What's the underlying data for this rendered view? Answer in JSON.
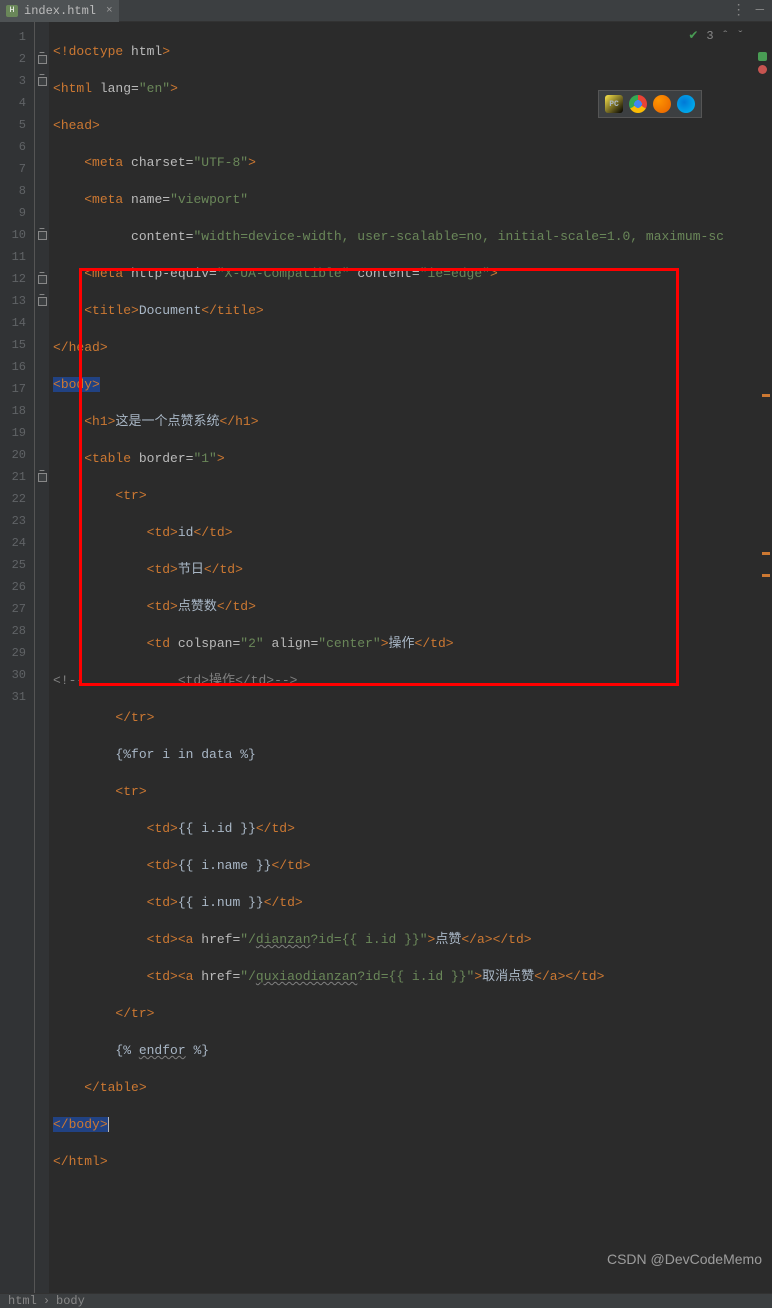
{
  "tab": {
    "filename": "index.html"
  },
  "topright": {
    "warnings": "3"
  },
  "breadcrumb": {
    "c1": "html",
    "c2": "body"
  },
  "watermark": "CSDN @DevCodeMemo",
  "lines": {
    "n1": "1",
    "n2": "2",
    "n3": "3",
    "n4": "4",
    "n5": "5",
    "n6": "6",
    "n7": "7",
    "n8": "8",
    "n9": "9",
    "n10": "10",
    "n11": "11",
    "n12": "12",
    "n13": "13",
    "n14": "14",
    "n15": "15",
    "n16": "16",
    "n17": "17",
    "n18": "18",
    "n19": "19",
    "n20": "20",
    "n21": "21",
    "n22": "22",
    "n23": "23",
    "n24": "24",
    "n25": "25",
    "n26": "26",
    "n27": "27",
    "n28": "28",
    "n29": "29",
    "n30": "30",
    "n31": "31"
  },
  "code": {
    "l1": {
      "doctype": "!doctype ",
      "html": "html"
    },
    "l2": {
      "open": "html ",
      "attr": "lang=",
      "val": "\"en\""
    },
    "l3": {
      "tag": "head"
    },
    "l4": {
      "tag": "meta ",
      "attr": "charset=",
      "val": "\"UTF-8\""
    },
    "l5": {
      "tag": "meta ",
      "attr": "name=",
      "val": "\"viewport\""
    },
    "l6": {
      "attr": "content=",
      "val": "\"width=device-width, user-scalable=no, initial-scale=1.0, maximum-sc"
    },
    "l7": {
      "tag": "meta ",
      "attr1": "http-equiv=",
      "val1": "\"X-UA-Compatible\" ",
      "attr2": "content=",
      "val2": "\"ie=edge\""
    },
    "l8": {
      "tag": "title",
      "txt": "Document"
    },
    "l9": {
      "tag": "head"
    },
    "l10": {
      "tag": "body"
    },
    "l11": {
      "tag": "h1",
      "txt": "这是一个点赞系统"
    },
    "l12": {
      "tag": "table ",
      "attr": "border=",
      "val": "\"1\""
    },
    "l13": {
      "tag": "tr"
    },
    "l14": {
      "tag": "td",
      "txt": "id"
    },
    "l15": {
      "tag": "td",
      "txt": "节日"
    },
    "l16": {
      "tag": "td",
      "txt": "点赞数"
    },
    "l17": {
      "tag": "td ",
      "attr1": "colspan=",
      "val1": "\"2\" ",
      "attr2": "align=",
      "val2": "\"center\"",
      "txt": "操作"
    },
    "l18": {
      "open": "<!--",
      "mid": "            <td>",
      "txt": "操作",
      "end": "</td>-->"
    },
    "l19": {
      "tag": "tr"
    },
    "l20": {
      "txt": "{%for i in data %}"
    },
    "l21": {
      "tag": "tr"
    },
    "l22": {
      "tag": "td",
      "txt": "{{ i.id }}"
    },
    "l23": {
      "tag": "td",
      "txt": "{{ i.name }}"
    },
    "l24": {
      "tag": "td",
      "txt": "{{ i.num }}"
    },
    "l25": {
      "tag": "td",
      "atag": "a ",
      "attr": "href=",
      "val": "\"/",
      "path": "dianzan",
      "rest": "?id={{ i.id }}\"",
      "txt": "点赞"
    },
    "l26": {
      "tag": "td",
      "atag": "a ",
      "attr": "href=",
      "val": "\"/",
      "path": "quxiaodianzan",
      "rest": "?id={{ i.id }}\"",
      "txt": "取消点赞"
    },
    "l27": {
      "tag": "tr"
    },
    "l28": {
      "open": "{% ",
      "mid": "endfor",
      " end": " %}"
    },
    "l29": {
      "tag": "table"
    },
    "l30": {
      "tag": "body"
    },
    "l31": {
      "tag": "html"
    }
  }
}
